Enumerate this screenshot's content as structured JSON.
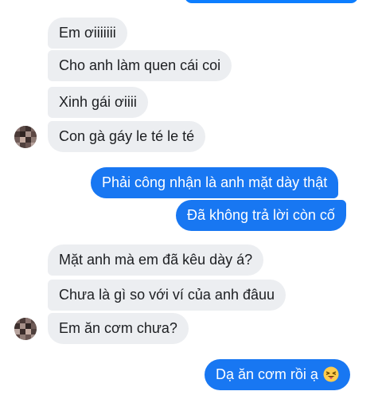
{
  "conversation": {
    "incoming_group_1": [
      "Em ơiiiiiii",
      "Cho anh làm quen cái coi",
      "Xinh gái ơiiii",
      "Con gà gáy le té le té"
    ],
    "outgoing_group_1": [
      "Phải công nhận là anh mặt dày thật",
      "Đã không trả lời còn cố"
    ],
    "incoming_group_2": [
      "Mặt anh mà em đã kêu dày á?",
      "Chưa là gì so với ví của anh đâuu",
      "Em ăn cơm chưa?"
    ],
    "outgoing_group_2": [
      "Dạ ăn cơm rồi ạ"
    ]
  },
  "icons": {
    "avatar": "blurred-avatar-icon",
    "emoji": "tongue-out-emoji-icon"
  },
  "colors": {
    "incoming_bubble": "#eceef1",
    "outgoing_bubble": "#1877f2",
    "incoming_text": "#1c1e21",
    "outgoing_text": "#ffffff"
  }
}
